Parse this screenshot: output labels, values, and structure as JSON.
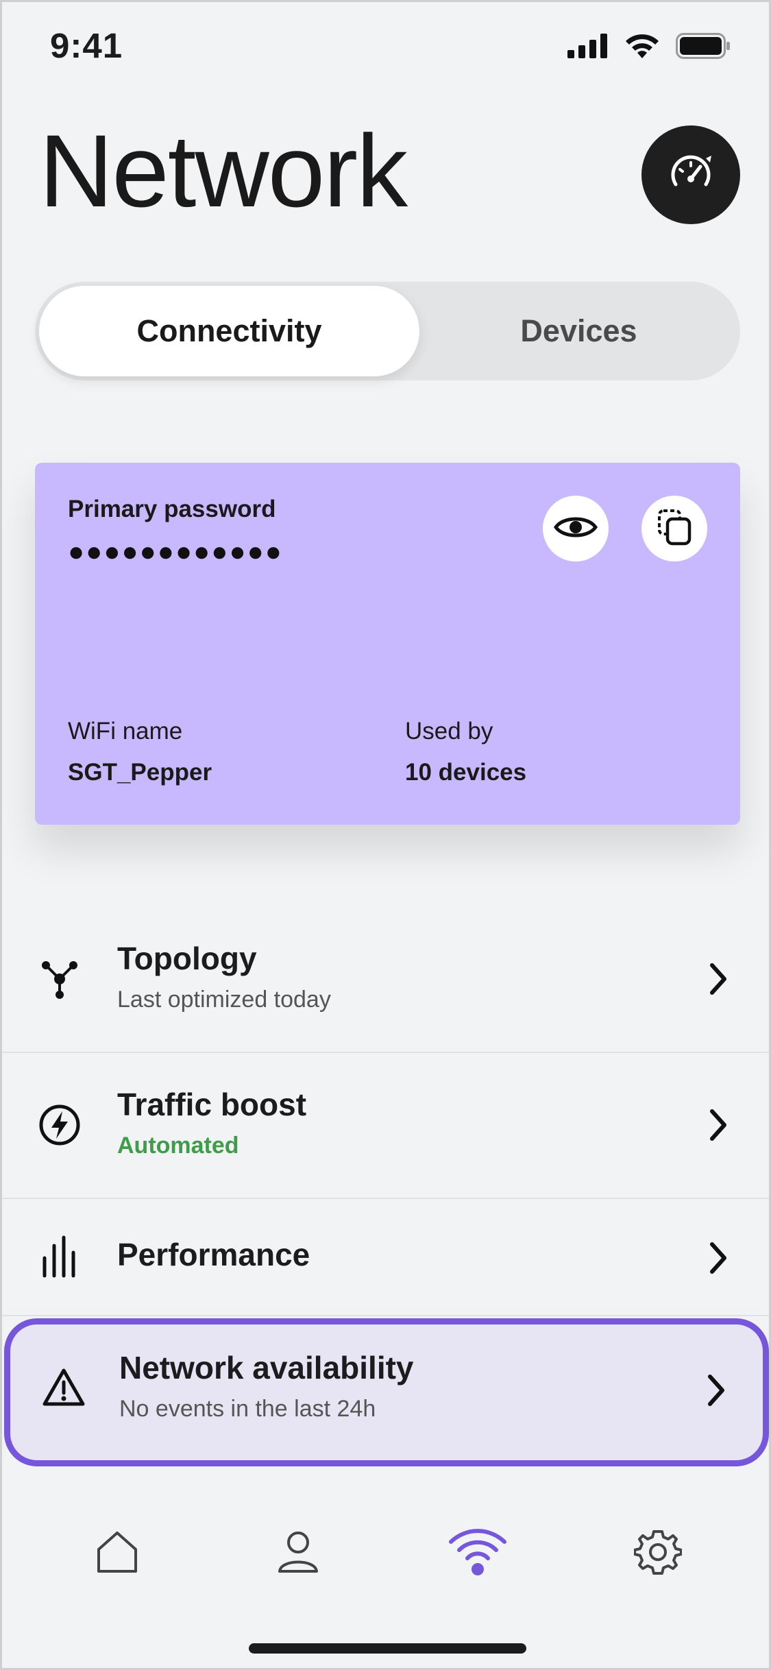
{
  "status_bar": {
    "time": "9:41",
    "icons": [
      "cellular-signal-icon",
      "wifi-icon",
      "battery-icon"
    ]
  },
  "header": {
    "title": "Network",
    "speed_test_icon": "speedometer-icon"
  },
  "segmented_control": {
    "tabs": [
      {
        "label": "Connectivity",
        "selected": true
      },
      {
        "label": "Devices",
        "selected": false
      }
    ]
  },
  "password_card": {
    "label": "Primary password",
    "masked_password": "●●●●●●●●●●●●",
    "background_color": "#c8b8fd",
    "wifi_name_label": "WiFi name",
    "wifi_name_value": "SGT_Pepper",
    "used_by_label": "Used by",
    "used_by_value": "10 devices",
    "actions": [
      "eye-icon",
      "copy-icon"
    ]
  },
  "list": {
    "items": [
      {
        "title": "Topology",
        "subtitle": "Last optimized today",
        "icon": "topology-icon"
      },
      {
        "title": "Traffic boost",
        "subtitle": "Automated",
        "icon": "lightning-icon",
        "subtitle_color": "#3f9c49"
      },
      {
        "title": "Performance",
        "subtitle": "",
        "icon": "bar-chart-icon"
      },
      {
        "title": "Network availability",
        "subtitle": "No events in the last 24h",
        "icon": "warning-icon",
        "highlighted": true
      }
    ]
  },
  "tab_bar": {
    "items": [
      {
        "icon": "home-icon",
        "selected": false
      },
      {
        "icon": "profile-icon",
        "selected": false
      },
      {
        "icon": "wifi-icon",
        "selected": true
      },
      {
        "icon": "gear-icon",
        "selected": false
      }
    ],
    "active_color": "#7656db"
  }
}
